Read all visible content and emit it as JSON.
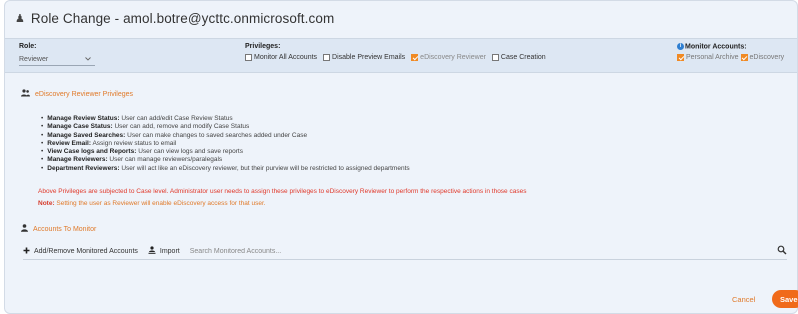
{
  "dialog": {
    "title": "Role Change - amol.botre@ycttc.onmicrosoft.com"
  },
  "role": {
    "label": "Role:",
    "value": "Reviewer"
  },
  "privileges": {
    "label": "Privileges:",
    "options": [
      {
        "label": "Monitor All Accounts",
        "checked": false
      },
      {
        "label": "Disable Preview Emails",
        "checked": false
      },
      {
        "label": "eDiscovery Reviewer",
        "checked": true
      },
      {
        "label": "Case Creation",
        "checked": false
      }
    ]
  },
  "monitor": {
    "label": "Monitor Accounts:",
    "options": [
      {
        "label": "Personal Archive",
        "checked": true
      },
      {
        "label": "eDiscovery",
        "checked": true
      }
    ]
  },
  "ediscovery_section": {
    "heading": "eDiscovery Reviewer Privileges",
    "items": [
      {
        "key": "Manage Review Status:",
        "text": " User can add/edit Case Review Status"
      },
      {
        "key": "Manage Case Status:",
        "text": " User can add, remove and modify Case Status"
      },
      {
        "key": "Manage Saved Searches:",
        "text": " User can make changes to saved searches added under Case"
      },
      {
        "key": "Review Email:",
        "text": " Assign review status to email"
      },
      {
        "key": "View Case logs and Reports:",
        "text": " User can view logs and save reports"
      },
      {
        "key": "Manage Reviewers:",
        "text": " User can manage reviewers/paralegals"
      },
      {
        "key": "Department Reviewers:",
        "text": " User will act like an eDiscovery reviewer, but their purview will be restricted to assigned departments"
      }
    ],
    "notice": "Above Privileges are subjected to Case level. Administrator user needs to assign these privileges to eDiscovery Reviewer to perform the respective actions in those cases",
    "note_key": "Note:",
    "note_text": " Setting the user as Reviewer will enable eDiscovery access for that user."
  },
  "accounts_section": {
    "heading": "Accounts To Monitor",
    "add_remove_label": "Add/Remove Monitored Accounts",
    "import_label": "Import",
    "search_placeholder": "Search Monitored Accounts..."
  },
  "footer": {
    "cancel_label": "Cancel",
    "save_label": "Save"
  },
  "colors": {
    "accent": "#f06a1a",
    "link_orange": "#e07a2a",
    "warning_red": "#e0392b",
    "header_band": "#dde7f3",
    "info_blue": "#2f7fd1"
  },
  "icons": [
    "user-icon",
    "chevron-down-icon",
    "checkbox-icon",
    "info-icon",
    "users-icon",
    "plus-icon",
    "upload-icon",
    "search-icon"
  ]
}
